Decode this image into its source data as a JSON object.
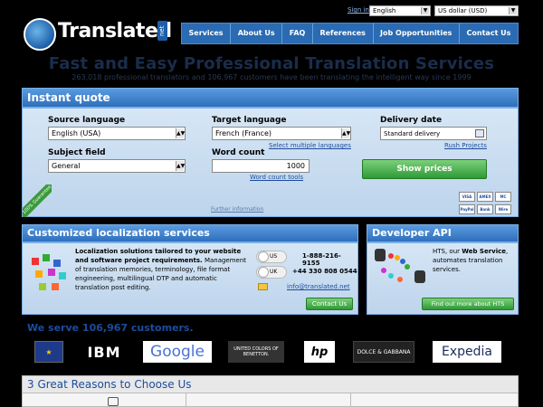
{
  "brand": {
    "logo_text": "Translated",
    "logo_suffix": "net"
  },
  "topbar": {
    "signin": "Sign in",
    "language": "English",
    "currency": "US dollar (USD)"
  },
  "nav": [
    "Services",
    "About Us",
    "FAQ",
    "References",
    "Job Opportunities",
    "Contact Us"
  ],
  "hero": {
    "headline": "Fast and Easy Professional Translation Services",
    "subline": "263,018 professional translators and 106,967 customers have been translating the intelligent way since 1999"
  },
  "quote": {
    "title": "Instant quote",
    "source_label": "Source language",
    "source_value": "English (USA)",
    "target_label": "Target language",
    "target_value": "French (France)",
    "multi_link": "Select multiple languages",
    "delivery_label": "Delivery date",
    "delivery_value": "Standard delivery",
    "rush_link": "Rush Projects",
    "subject_label": "Subject field",
    "subject_value": "General",
    "wordcount_label": "Word count",
    "wordcount_value": "1000",
    "wordcount_tools": "Word count tools",
    "show_prices": "Show prices",
    "guarantee": "100% Guarantee",
    "further": "Further information",
    "payments": [
      "VISA",
      "AMEX",
      "MC",
      "PayPal",
      "Bank",
      "Wire"
    ]
  },
  "localization": {
    "title": "Customized localization services",
    "bold_intro": "Localization solutions tailored to your website and software project requirements.",
    "body": "Management of translation memories, terminology, file format engineering, multilingual DTP and automatic translation post editing.",
    "us_label": "US",
    "us_phone": "1-888-216-9155",
    "uk_label": "UK",
    "uk_phone": "+44 330 808 0544",
    "email": "info@translated.net",
    "contact_button": "Contact Us"
  },
  "developer": {
    "title": "Developer API",
    "text_a": "HTS, our ",
    "text_bold": "Web Service",
    "text_b": ", automates translation services.",
    "button": "Find out more about HTS"
  },
  "customers": {
    "title": "We serve 106,967 customers.",
    "logos": [
      "EU",
      "IBM",
      "Google",
      "UNITED COLORS OF BENETTON.",
      "hp",
      "DOLCE & GABBANA",
      "Expedia"
    ]
  },
  "reasons": {
    "title": "3 Great Reasons to Choose Us"
  }
}
